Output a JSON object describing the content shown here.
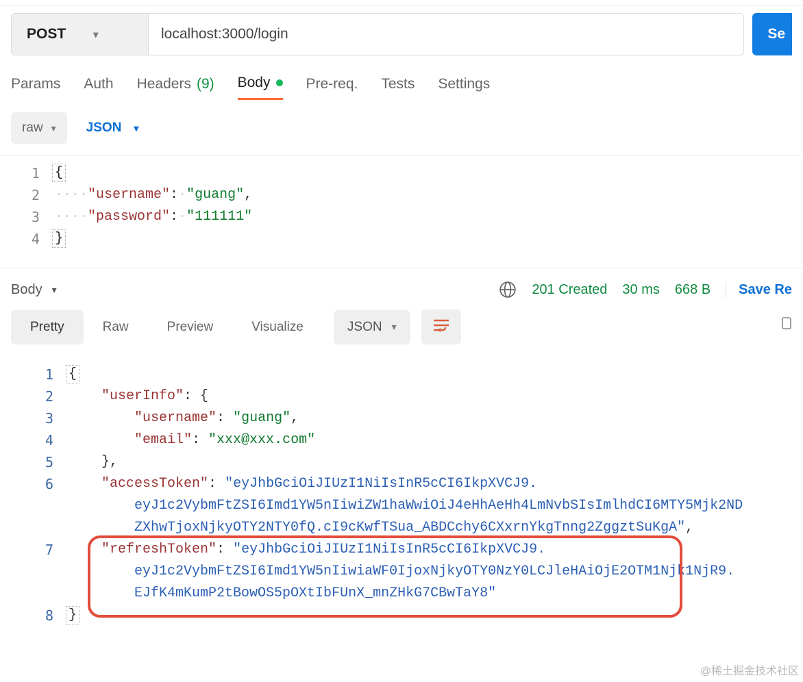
{
  "request": {
    "method": "POST",
    "url": "localhost:3000/login",
    "send_label": "Se"
  },
  "req_tabs": {
    "params": "Params",
    "auth": "Auth",
    "headers_label": "Headers",
    "headers_count": "(9)",
    "body": "Body",
    "prereq": "Pre-req.",
    "tests": "Tests",
    "settings": "Settings"
  },
  "body_bar": {
    "mode": "raw",
    "type": "JSON"
  },
  "req_body": {
    "l1": "{",
    "l2_key": "\"username\"",
    "l2_val": "\"guang\"",
    "l3_key": "\"password\"",
    "l3_val": "\"111111\"",
    "l4": "}"
  },
  "response_head": {
    "tab": "Body",
    "status": "201 Created",
    "time": "30 ms",
    "size": "668 B",
    "save": "Save Re"
  },
  "res_tabs": {
    "pretty": "Pretty",
    "raw": "Raw",
    "preview": "Preview",
    "visualize": "Visualize",
    "type": "JSON"
  },
  "res_body": {
    "l1": "{",
    "l2_key": "\"userInfo\"",
    "l3_key": "\"username\"",
    "l3_val": "\"guang\"",
    "l4_key": "\"email\"",
    "l4_val": "\"xxx@xxx.com\"",
    "l6_key": "\"accessToken\"",
    "l6_val_a": "\"eyJhbGciOiJIUzI1NiIsInR5cCI6IkpXVCJ9.",
    "l6_val_b": "eyJ1c2VybmFtZSI6Imd1YW5nIiwiZW1haWwiOiJ4eHhAeHh4LmNvbSIsImlhdCI6MTY5Mjk2ND",
    "l6_val_c": "ZXhwTjoxNjkyOTY2NTY0fQ.cI9cKwfTSua_ABDCchy6CXxrnYkgTnng2ZggztSuKgA\"",
    "l7_key": "\"refreshToken\"",
    "l7_val_a": "\"eyJhbGciOiJIUzI1NiIsInR5cCI6IkpXVCJ9.",
    "l7_val_b": "eyJ1c2VybmFtZSI6Imd1YW5nIiwiaWF0IjoxNjkyOTY0NzY0LCJleHAiOjE2OTM1Njk1NjR9.",
    "l7_val_c": "EJfK4mKumP2tBowOS5pOXtIbFUnX_mnZHkG7CBwTaY8\"",
    "l8": "}"
  },
  "watermark": "@稀土掘金技术社区"
}
